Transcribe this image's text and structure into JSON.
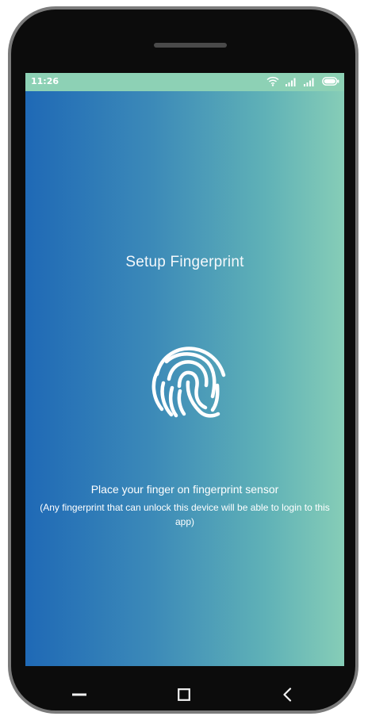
{
  "status_bar": {
    "time": "11:26",
    "icons": [
      "wifi-icon",
      "signal-icon",
      "signal-icon",
      "battery-icon"
    ]
  },
  "setup": {
    "title": "Setup Fingerprint",
    "icon": "fingerprint-icon",
    "instruction": "Place your finger on fingerprint sensor",
    "note": "(Any fingerprint that can unlock this device will be able to login to this app)"
  },
  "nav_bar": {
    "buttons": [
      "menu-icon",
      "home-icon",
      "back-icon"
    ]
  },
  "colors": {
    "gradient_start": "#1f69b6",
    "gradient_end": "#86cdb7",
    "status_bar": "#8dd1b5",
    "text": "#ffffff"
  }
}
